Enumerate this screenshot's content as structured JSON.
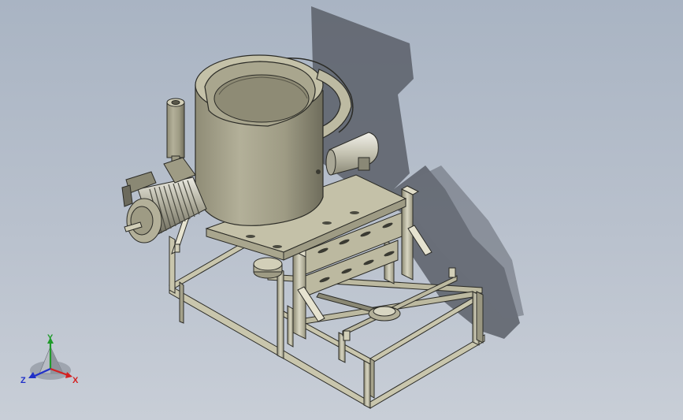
{
  "view": {
    "background_top": "#a9b4c3",
    "background_bottom": "#c8ced7",
    "model_color": "#c9c6ad",
    "edge_color": "#2b2b26"
  },
  "triad": {
    "x_label": "X",
    "y_label": "Y",
    "z_label": "Z",
    "x_color": "#d42020",
    "y_color": "#1f9a2a",
    "z_color": "#2030c8"
  }
}
